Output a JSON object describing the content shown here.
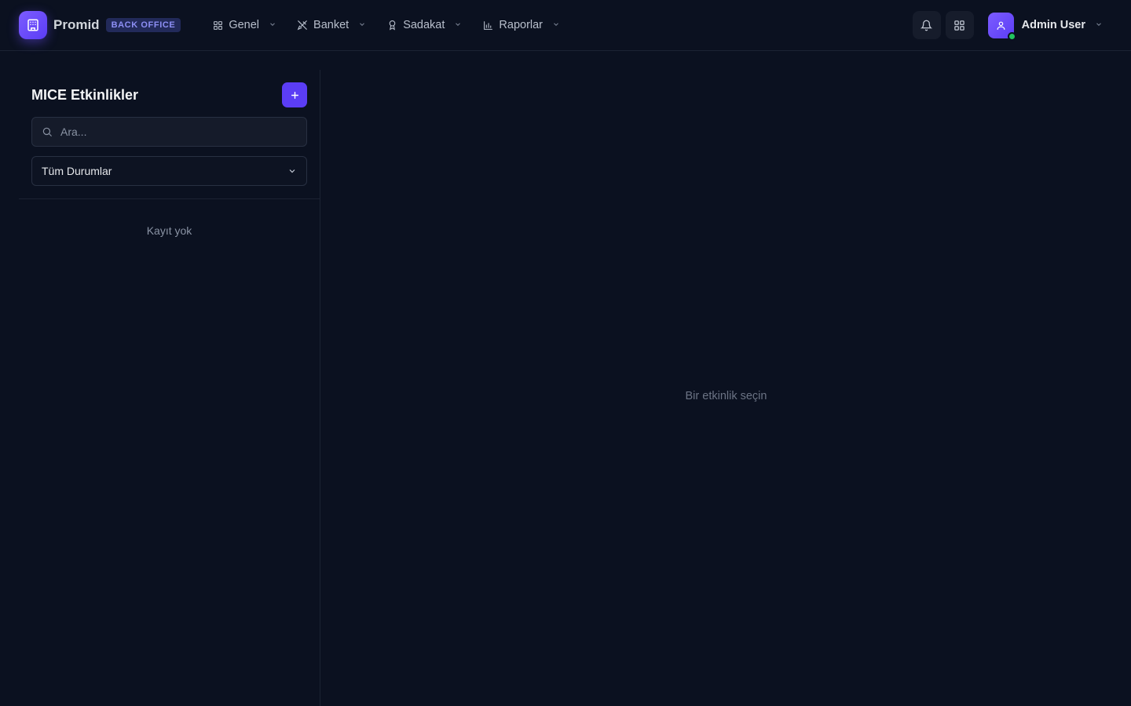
{
  "app": {
    "brand": "Promid",
    "badge": "BACK OFFICE"
  },
  "nav": {
    "items": [
      {
        "label": "Genel",
        "icon": "grid-icon"
      },
      {
        "label": "Banket",
        "icon": "utensils-icon"
      },
      {
        "label": "Sadakat",
        "icon": "award-icon"
      },
      {
        "label": "Raporlar",
        "icon": "bar-chart-icon"
      }
    ]
  },
  "user": {
    "name": "Admin User",
    "status_color": "#22c55e"
  },
  "sidebar": {
    "title": "MICE Etkinlikler",
    "search_placeholder": "Ara...",
    "filter_selected": "Tüm Durumlar",
    "empty_text": "Kayıt yok"
  },
  "main": {
    "empty_text": "Bir etkinlik seçin"
  },
  "colors": {
    "background": "#0b1120",
    "accent": "#5b3df5",
    "badge_bg": "#222a5a",
    "badge_text": "#8d8ff5"
  }
}
